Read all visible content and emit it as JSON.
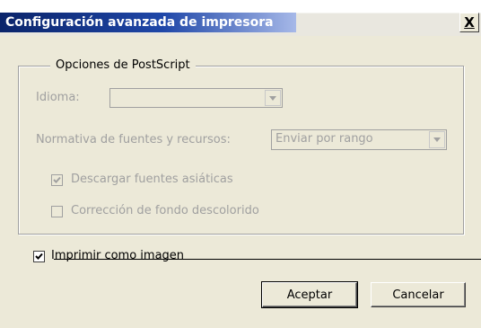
{
  "window": {
    "title": "Configuración avanzada de impresora",
    "close_label": "X"
  },
  "postscript_group": {
    "legend": "Opciones de PostScript",
    "language_label": "Idioma:",
    "language_value": "",
    "font_policy_label": "Normativa de fuentes y recursos:",
    "font_policy_value": "Enviar por rango",
    "download_asian_fonts_label": "Descargar fuentes asiáticas",
    "download_asian_fonts_checked": true,
    "faded_bg_correction_label": "Corrección de fondo descolorido",
    "faded_bg_correction_checked": false
  },
  "print_as_image": {
    "label": "Imprimir como imagen",
    "checked": true
  },
  "buttons": {
    "ok_label": "Aceptar",
    "cancel_label": "Cancelar"
  },
  "colors": {
    "title_bar": "#0a246a",
    "dialog_bg": "#ece9d8",
    "disabled_text": "#a0a0a0"
  }
}
